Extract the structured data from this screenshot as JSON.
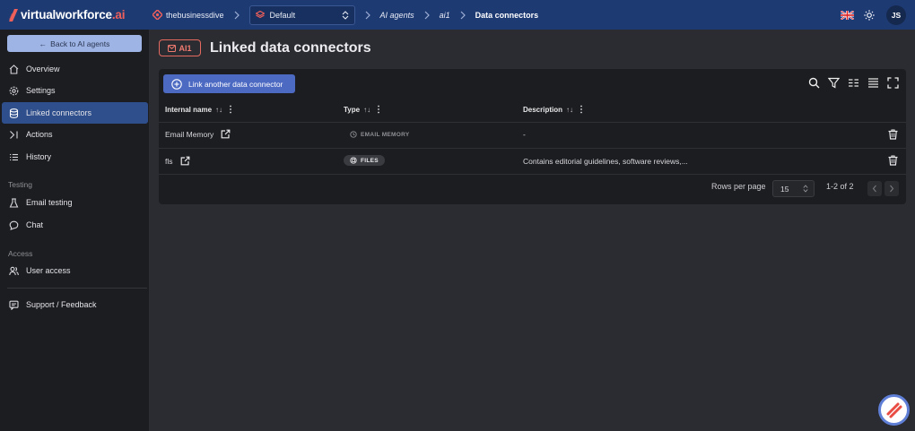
{
  "brand": {
    "name_main": "virtualworkforce",
    "name_suffix": ".ai",
    "accent": "#f0605a"
  },
  "breadcrumb": {
    "org": "thebusinessdive",
    "workspace": "Default",
    "section": "AI agents",
    "agent": "ai1",
    "current": "Data connectors"
  },
  "top_right": {
    "language_flag": "uk-flag-icon",
    "theme_icon": "sun-icon",
    "user_initials": "JS"
  },
  "sidebar": {
    "back_label": "Back to AI agents",
    "items": [
      {
        "label": "Overview",
        "icon": "home-icon"
      },
      {
        "label": "Settings",
        "icon": "gear-icon"
      },
      {
        "label": "Linked connectors",
        "icon": "database-icon",
        "active": true
      },
      {
        "label": "Actions",
        "icon": "actions-icon"
      },
      {
        "label": "History",
        "icon": "list-icon"
      }
    ],
    "testing_label": "Testing",
    "testing_items": [
      {
        "label": "Email testing",
        "icon": "flask-icon"
      },
      {
        "label": "Chat",
        "icon": "chat-icon"
      }
    ],
    "access_label": "Access",
    "access_items": [
      {
        "label": "User access",
        "icon": "users-icon"
      }
    ],
    "support_label": "Support / Feedback"
  },
  "header": {
    "badge": "AI1",
    "title": "Linked data connectors"
  },
  "toolbar": {
    "link_button": "Link another data connector"
  },
  "table": {
    "columns": [
      {
        "label": "Internal name",
        "sort": "↑↓"
      },
      {
        "label": "Type",
        "sort": "↑↓"
      },
      {
        "label": "Description",
        "sort": "↑↓"
      }
    ],
    "rows": [
      {
        "name": "Email Memory",
        "type": "EMAIL MEMORY",
        "description": "-"
      },
      {
        "name": "fls",
        "type": "FILES",
        "description": "Contains editorial guidelines, software reviews,..."
      }
    ]
  },
  "pagination": {
    "rows_per_page_label": "Rows per page",
    "rows_per_page": "15",
    "range": "1-2 of 2"
  }
}
